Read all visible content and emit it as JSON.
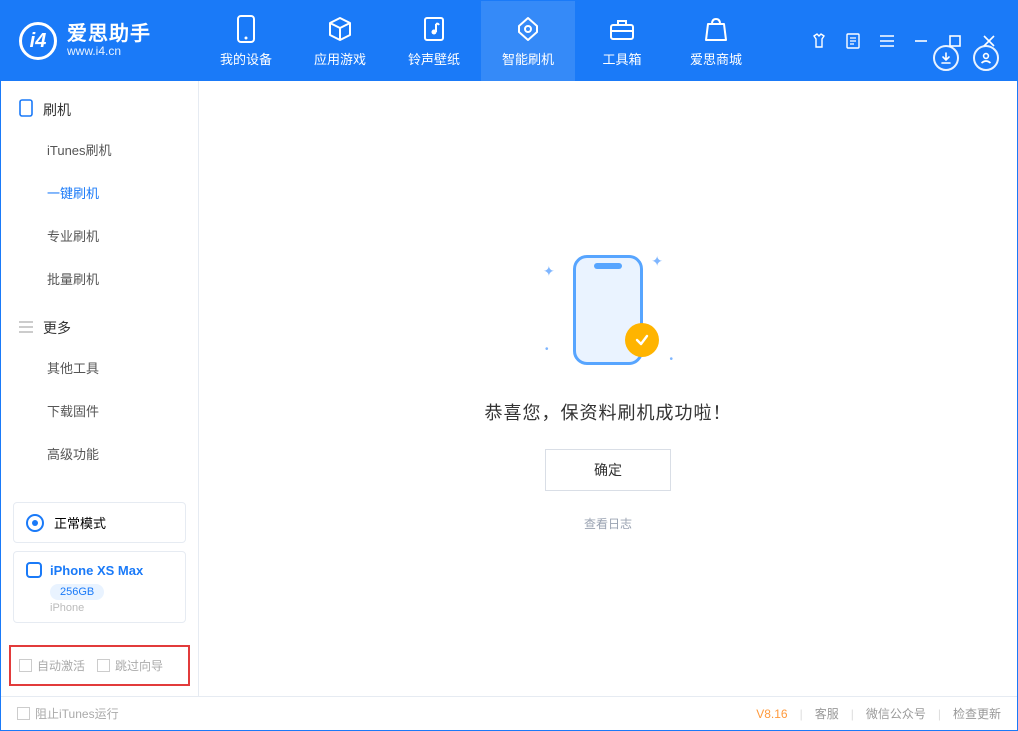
{
  "app": {
    "name_cn": "爱思助手",
    "name_en": "www.i4.cn"
  },
  "tabs": [
    {
      "label": "我的设备",
      "icon": "device-icon"
    },
    {
      "label": "应用游戏",
      "icon": "cube-icon"
    },
    {
      "label": "铃声壁纸",
      "icon": "music-icon"
    },
    {
      "label": "智能刷机",
      "icon": "flash-icon",
      "active": true
    },
    {
      "label": "工具箱",
      "icon": "toolbox-icon"
    },
    {
      "label": "爱思商城",
      "icon": "bag-icon"
    }
  ],
  "sidebar": {
    "groups": [
      {
        "title": "刷机",
        "icon": "phone-outline-icon",
        "items": [
          {
            "label": "iTunes刷机"
          },
          {
            "label": "一键刷机",
            "active": true
          },
          {
            "label": "专业刷机"
          },
          {
            "label": "批量刷机"
          }
        ]
      },
      {
        "title": "更多",
        "icon": "list-icon",
        "items": [
          {
            "label": "其他工具"
          },
          {
            "label": "下载固件"
          },
          {
            "label": "高级功能"
          }
        ]
      }
    ],
    "mode_card": "正常模式",
    "device": {
      "name": "iPhone XS Max",
      "storage": "256GB",
      "type": "iPhone"
    },
    "checkboxes": [
      {
        "label": "自动激活"
      },
      {
        "label": "跳过向导"
      }
    ]
  },
  "main": {
    "success_text": "恭喜您，保资料刷机成功啦！",
    "ok_button": "确定",
    "view_log": "查看日志"
  },
  "statusbar": {
    "block_itunes": "阻止iTunes运行",
    "version": "V8.16",
    "links": [
      "客服",
      "微信公众号",
      "检查更新"
    ]
  }
}
